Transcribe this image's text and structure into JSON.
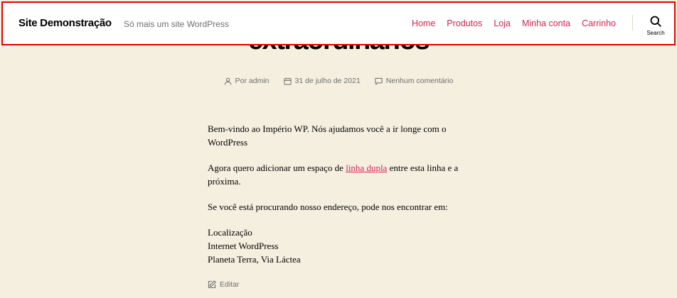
{
  "header": {
    "site_title": "Site Demonstração",
    "site_description": "Só mais um site WordPress",
    "nav": [
      "Home",
      "Produtos",
      "Loja",
      "Minha conta",
      "Carrinho"
    ],
    "search_label": "Search"
  },
  "post": {
    "title_visible": "extraordinários",
    "meta": {
      "author": "Por admin",
      "date": "31 de julho de 2021",
      "comments": "Nenhum comentário"
    },
    "p1": "Bem-vindo ao Império WP. Nós ajudamos você a ir longe com o WordPress",
    "p2_before": "Agora quero adicionar um espaço de ",
    "p2_link": "linha dupla",
    "p2_after": " entre esta linha e a próxima.",
    "p3": "Se você está procurando nosso endereço, pode nos encontrar em:",
    "address": [
      "Localização",
      "Internet WordPress",
      "Planeta Terra, Via Láctea"
    ],
    "edit_label": "Editar"
  },
  "colors": {
    "accent": "#cd2653",
    "background": "#f5efe0",
    "highlight_border": "#e10000"
  }
}
